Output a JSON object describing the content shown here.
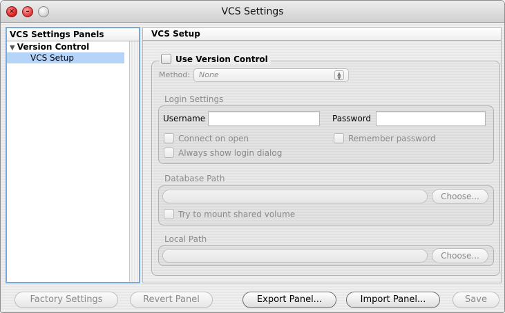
{
  "window": {
    "title": "VCS Settings"
  },
  "sidebar": {
    "header": "VCS Settings Panels",
    "tree": {
      "parent_label": "Version Control",
      "child_label": "VCS Setup"
    }
  },
  "panel": {
    "header": "VCS Setup",
    "use_version_control": {
      "label": "Use Version Control",
      "checked": false
    },
    "method": {
      "label": "Method:",
      "selected": "None"
    },
    "login": {
      "title": "Login Settings",
      "username_label": "Username",
      "username_value": "",
      "password_label": "Password",
      "password_value": "",
      "connect_on_open": "Connect on open",
      "remember_password": "Remember password",
      "always_show_login": "Always show login dialog"
    },
    "database_path": {
      "title": "Database Path",
      "value": "",
      "choose_label": "Choose...",
      "mount_shared": "Try to mount shared volume"
    },
    "local_path": {
      "title": "Local Path",
      "value": "",
      "choose_label": "Choose..."
    }
  },
  "footer": {
    "factory_settings": "Factory Settings",
    "revert_panel": "Revert Panel",
    "export_panel": "Export Panel...",
    "import_panel": "Import Panel...",
    "save": "Save"
  }
}
